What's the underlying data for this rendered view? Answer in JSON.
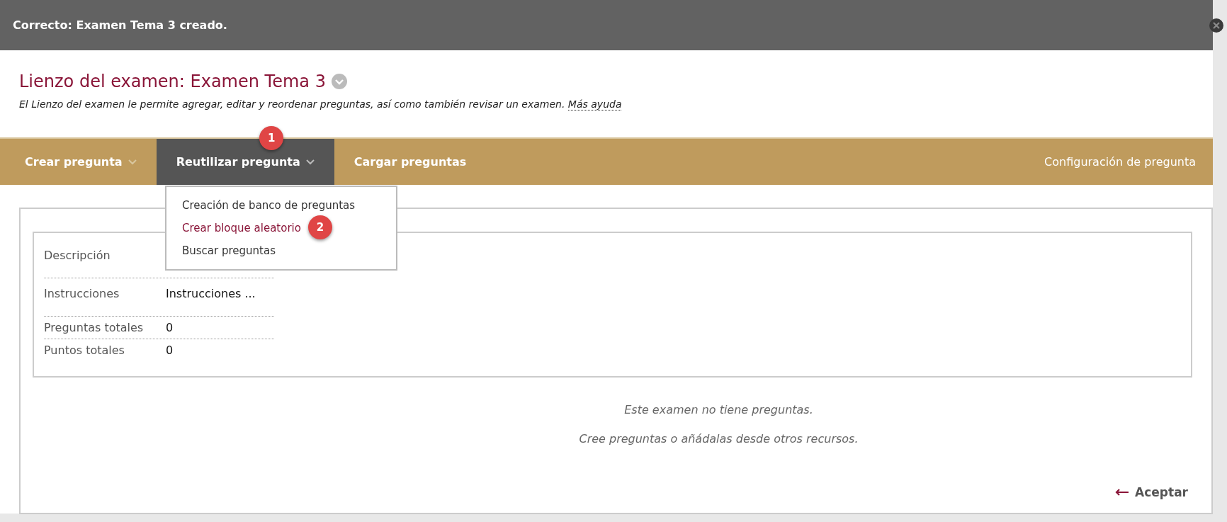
{
  "notification": {
    "message": "Correcto: Examen Tema 3 creado."
  },
  "header": {
    "title": "Lienzo del examen: Examen Tema 3",
    "description": "El Lienzo del examen le permite agregar, editar y reordenar preguntas, así como también revisar un examen.",
    "help_link": "Más ayuda"
  },
  "toolbar": {
    "items": [
      {
        "label": "Crear pregunta",
        "has_caret": true,
        "selected": false
      },
      {
        "label": "Reutilizar pregunta",
        "has_caret": true,
        "selected": true,
        "callout": "1"
      },
      {
        "label": "Cargar preguntas",
        "has_caret": false,
        "selected": false
      }
    ],
    "right_item": "Configuración de pregunta"
  },
  "dropdown": {
    "items": [
      {
        "label": "Creación de banco de preguntas",
        "highlighted": false
      },
      {
        "label": "Crear bloque aleatorio",
        "highlighted": true,
        "callout": "2"
      },
      {
        "label": "Buscar preguntas",
        "highlighted": false
      }
    ]
  },
  "details": [
    {
      "label": "Descripción"
    },
    {
      "label": "Instrucciones",
      "value": "Instrucciones ..."
    },
    {
      "label": "Preguntas totales",
      "value": "0"
    },
    {
      "label": "Puntos totales",
      "value": "0"
    }
  ],
  "empty_state": [
    "Este examen no tiene preguntas.",
    "Cree preguntas o añádalas desde otros recursos."
  ],
  "footer": {
    "button": "Aceptar"
  }
}
